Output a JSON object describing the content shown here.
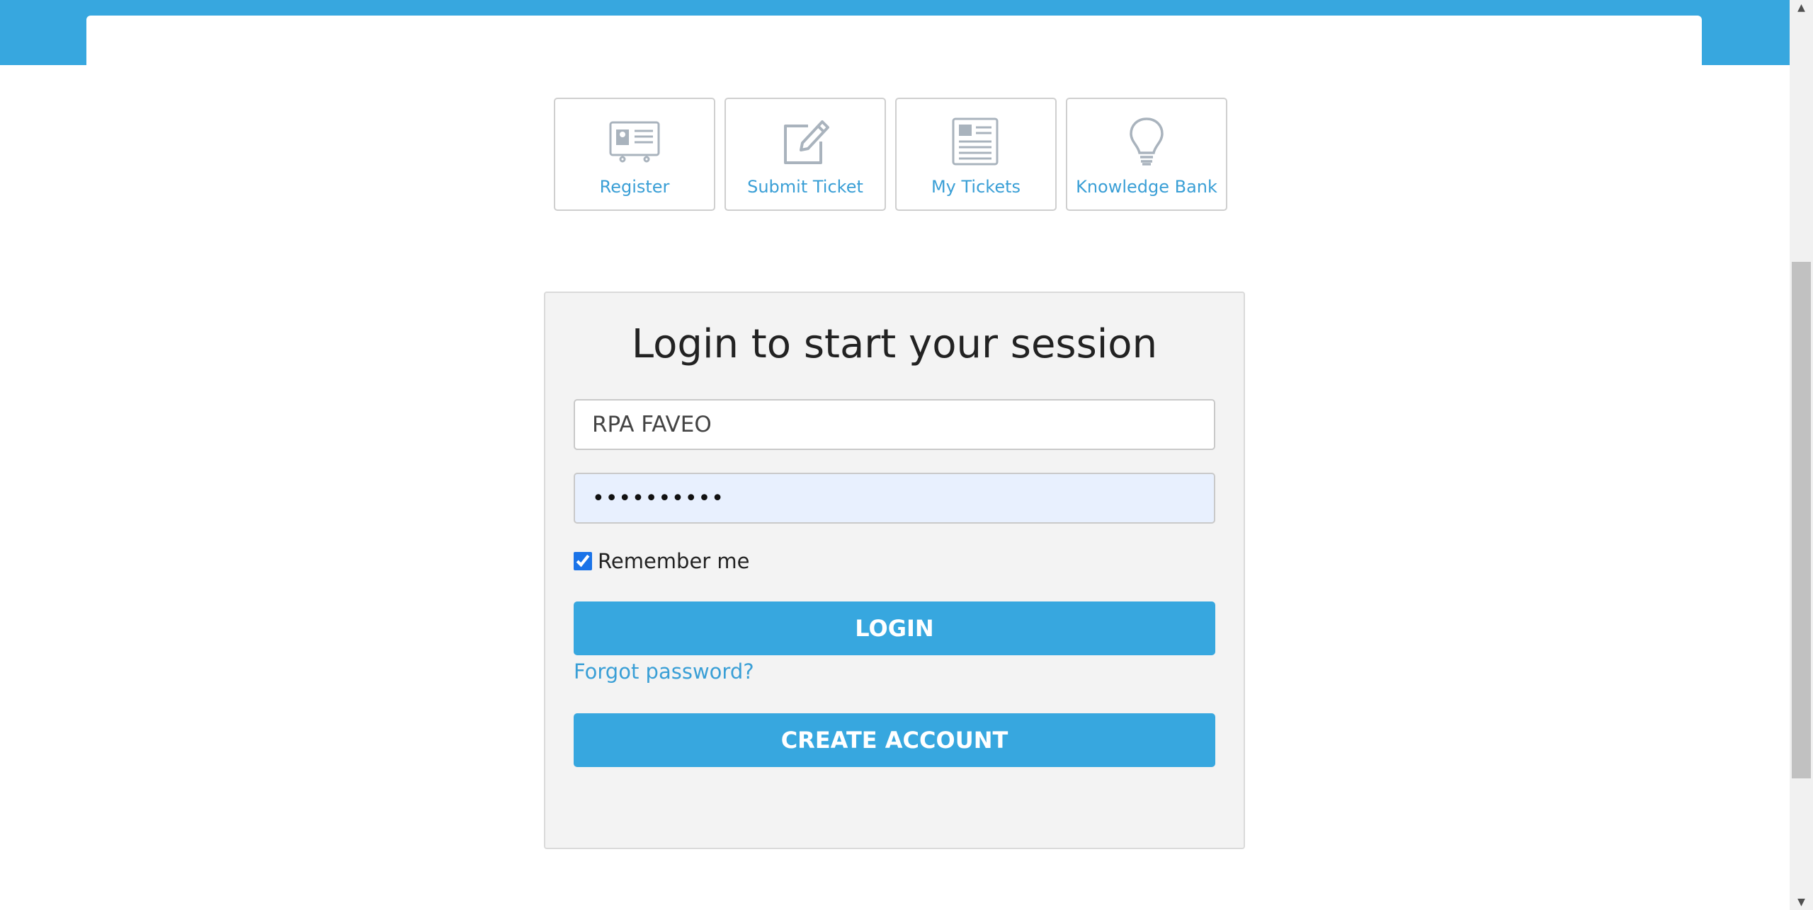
{
  "tiles": [
    {
      "label": "Register",
      "icon": "id-card-icon"
    },
    {
      "label": "Submit Ticket",
      "icon": "edit-icon"
    },
    {
      "label": "My Tickets",
      "icon": "newspaper-icon"
    },
    {
      "label": "Knowledge Bank",
      "icon": "lightbulb-icon"
    }
  ],
  "login": {
    "title": "Login to start your session",
    "username_value": "RPA FAVEO",
    "password_value": "••••••••••",
    "remember_label": "Remember me",
    "remember_checked": true,
    "login_label": "LOGIN",
    "forgot_label": "Forgot password?",
    "create_label": "CREATE ACCOUNT"
  },
  "scrollbar": {
    "up_arrow": "▲",
    "down_arrow": "▼"
  },
  "colors": {
    "brand": "#37a7df",
    "link": "#3a9fd6",
    "icon": "#a9b3bd"
  }
}
